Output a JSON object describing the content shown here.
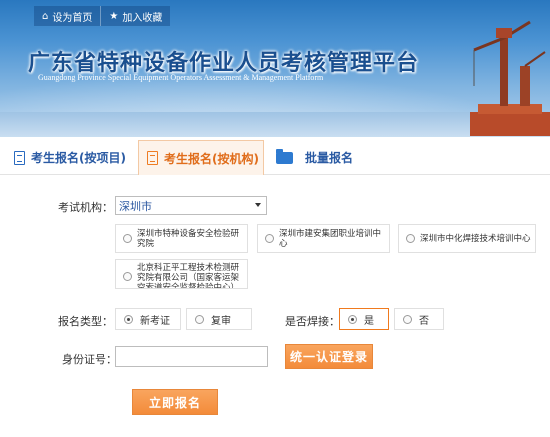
{
  "topbar": {
    "home_label": "设为首页",
    "favorite_label": "加入收藏"
  },
  "banner": {
    "title": "广东省特种设备作业人员考核管理平台",
    "subtitle": "Guangdong Province Special Equipment Operators Assessment & Management Platform"
  },
  "tabs": [
    {
      "label": "考生报名(按项目)",
      "active": false
    },
    {
      "label": "考生报名(按机构)",
      "active": true
    },
    {
      "label": "批量报名",
      "active": false
    }
  ],
  "form": {
    "institution_label": "考试机构：",
    "institution_value": "深圳市",
    "organizations": [
      "深圳市特种设备安全检验研究院",
      "深圳市建安集团职业培训中心",
      "深圳市中化焊接技术培训中心",
      "北京科正平工程技术检测研究院有限公司（国家客运架空索道安全监督检验中心）"
    ],
    "reg_type_label": "报名类型：",
    "reg_type_options": [
      "新考证",
      "复审"
    ],
    "reg_type_selected": "新考证",
    "welding_label": "是否焊接：",
    "welding_options": [
      "是",
      "否"
    ],
    "welding_selected": "是",
    "id_label": "身份证号：",
    "id_value": "",
    "unified_login_label": "统一认证登录",
    "submit_label": "立即报名"
  },
  "colors": {
    "accent_orange": "#f38b3a",
    "tab_blue": "#2a5aa3",
    "banner_blue": "#2a78bf"
  }
}
